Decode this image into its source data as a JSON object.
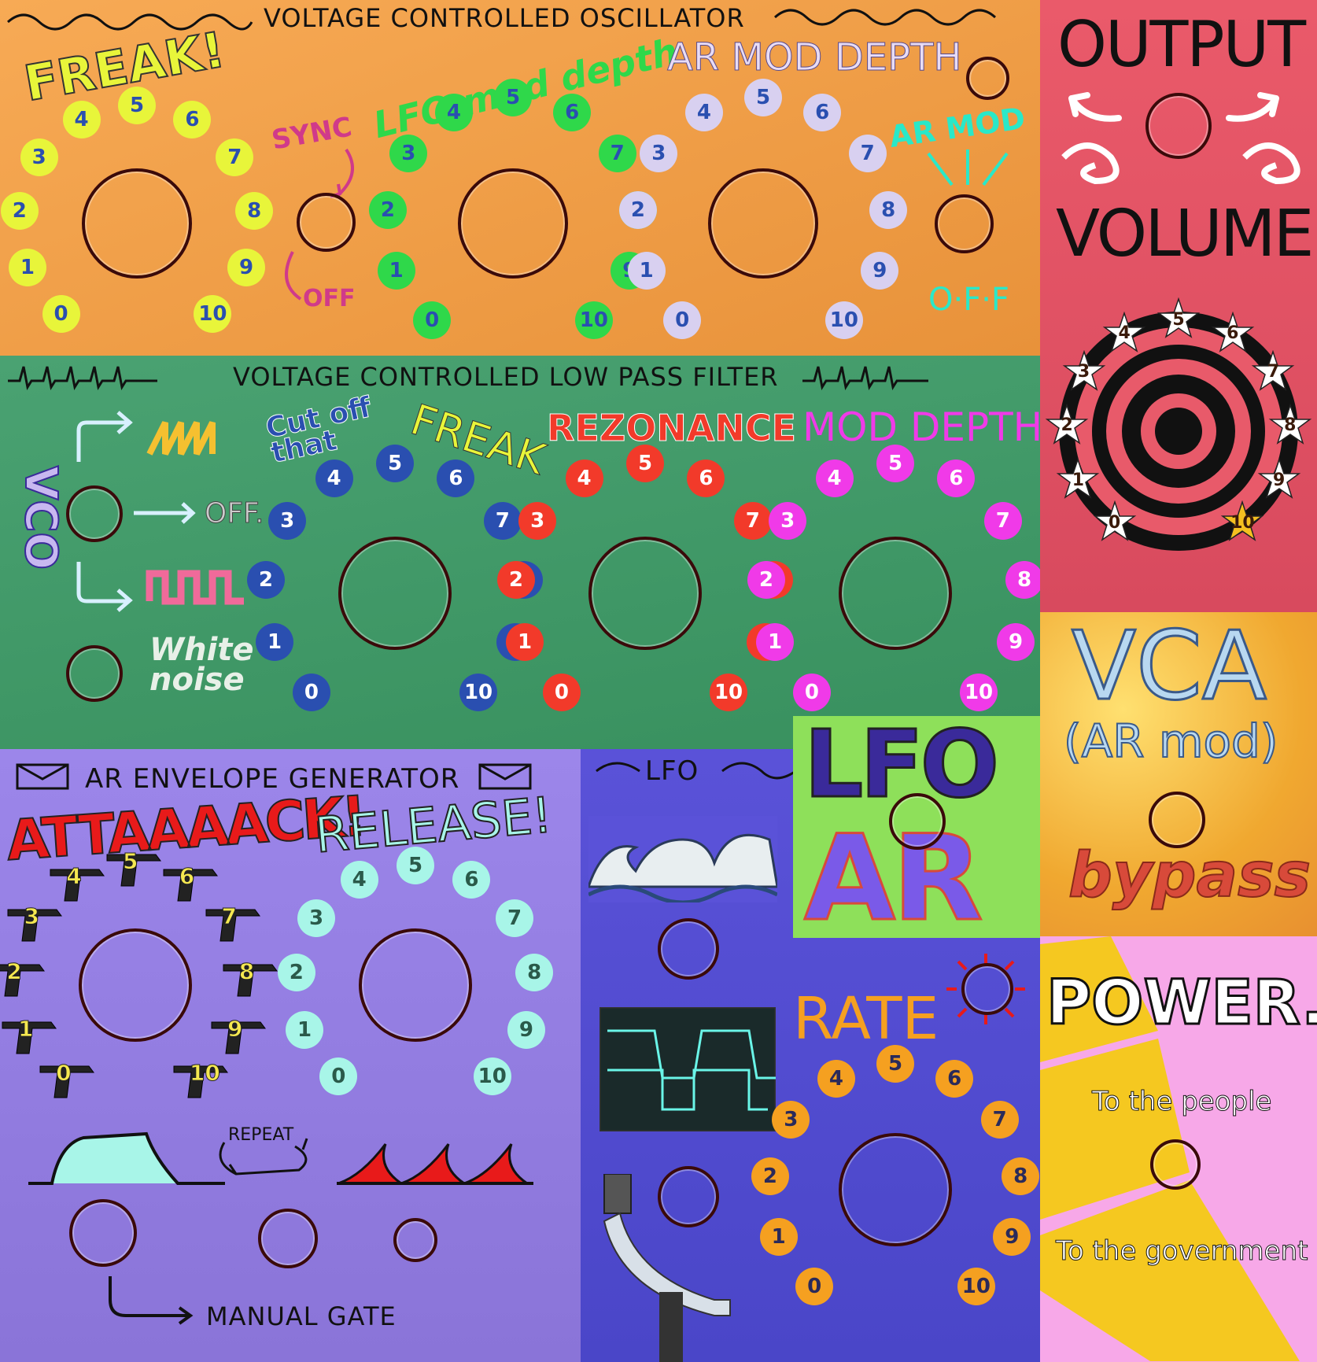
{
  "vco": {
    "title": "VOLTAGE CONTROLLED OSCILLATOR",
    "freak_label": "FREAK!",
    "sync_label": "SYNC",
    "sync_off_label": "OFF",
    "lfo_mod_label": "LFO mod depth",
    "ar_mod_depth_label": "AR MOD DEPTH",
    "ar_mod_label": "AR MOD",
    "ar_mod_off_label": "O·F·F",
    "dial_numbers": [
      "0",
      "1",
      "2",
      "3",
      "4",
      "5",
      "6",
      "7",
      "8",
      "9",
      "10"
    ]
  },
  "output": {
    "title": "OUTPUT",
    "volume_label": "VOLUME",
    "dial_numbers": [
      "0",
      "1",
      "2",
      "3",
      "4",
      "5",
      "6",
      "7",
      "8",
      "9",
      "10"
    ]
  },
  "vcf": {
    "title": "VOLTAGE CONTROLLED LOW PASS FILTER",
    "vco_label": "VCO",
    "off_label": "OFF.",
    "white_noise_label": "White noise",
    "cutoff_label": "Cut off that",
    "freak_label": "FREAK",
    "resonance_label": "REZONANCE",
    "mod_depth_label": "MOD DEPTH",
    "dial_numbers": [
      "0",
      "1",
      "2",
      "3",
      "4",
      "5",
      "6",
      "7",
      "8",
      "9",
      "10"
    ]
  },
  "lfo_ar": {
    "lfo_label": "LFO",
    "ar_label": "AR"
  },
  "vca": {
    "title": "VCA",
    "subtitle": "(AR mod)",
    "bypass_label": "bypass"
  },
  "envelope": {
    "title": "AR ENVELOPE GENERATOR",
    "attack_label": "ATTAAAACK!",
    "release_label": "RELEASE!",
    "repeat_label": "REPEAT",
    "manual_gate_label": "MANUAL GATE",
    "dial_numbers": [
      "0",
      "1",
      "2",
      "3",
      "4",
      "5",
      "6",
      "7",
      "8",
      "9",
      "10"
    ]
  },
  "lfo": {
    "title": "LFO",
    "rate_label": "RATE",
    "dial_numbers": [
      "0",
      "1",
      "2",
      "3",
      "4",
      "5",
      "6",
      "7",
      "8",
      "9",
      "10"
    ]
  },
  "power": {
    "title": "POWER.",
    "people_label": "To the people",
    "government_label": "To the government"
  },
  "colors": {
    "vco_bg": "#f5a24a",
    "output_bg": "#e85a6a",
    "vcf_bg": "#3f9a6a",
    "lfo_ar_bg": "#8ee05a",
    "vca_bg": "#f3b54a",
    "env_bg": "#9a84e8",
    "lfo_bg": "#5650d8",
    "power_bg": "#f7a8e8",
    "yellow_dot": "#e8f53a",
    "green_dot": "#2fd84a",
    "lavender_dot": "#d8d0f0",
    "blue_dot": "#2a4fb0",
    "red_dot": "#f23a2a",
    "magenta_dot": "#f03ae8",
    "cyan_dot": "#a8f5e8",
    "orange_dot": "#f5a020"
  }
}
